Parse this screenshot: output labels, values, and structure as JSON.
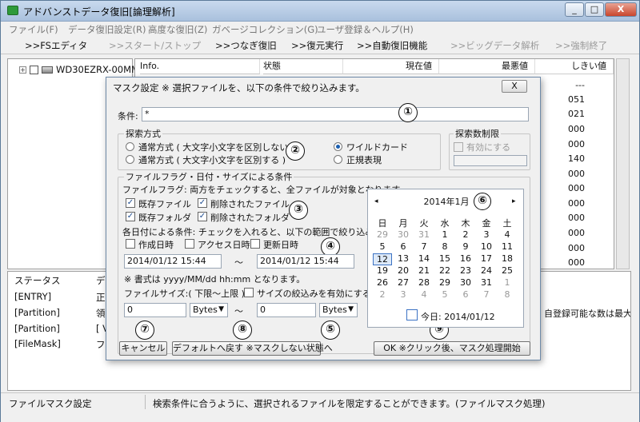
{
  "window": {
    "title": "アドバンストデータ復旧[論理解析]",
    "controls": [
      "_",
      "□",
      "X"
    ]
  },
  "menu": [
    "ファイル(F)",
    "データ復旧設定(R)",
    "高度な復旧(Z)",
    "ガベージコレクション(G)",
    "ユーザ登録＆ヘルプ(H)"
  ],
  "toolbar": [
    {
      "label": ">>FSエディタ",
      "enabled": true
    },
    {
      "label": ">>スタート/ストップ",
      "enabled": false
    },
    {
      "label": ">>つなぎ復旧",
      "enabled": true
    },
    {
      "label": ">>復元実行",
      "enabled": true
    },
    {
      "label": ">>自動復旧機能",
      "enabled": true
    },
    {
      "label": ">>ビッグデータ解析",
      "enabled": false
    },
    {
      "label": ">>強制終了",
      "enabled": false
    }
  ],
  "tree": {
    "expander": "+",
    "label": "WD30EZRX-00MMM"
  },
  "grid": {
    "columns": [
      "Info.",
      "状態",
      "現在値",
      "最悪値",
      "しきい値"
    ],
    "values": [
      "---",
      "051",
      "021",
      "000",
      "000",
      "140",
      "000",
      "000",
      "000",
      "000",
      "000",
      "000",
      "000",
      "000"
    ]
  },
  "log": {
    "columns": [
      "ステータス",
      "デ"
    ],
    "rows": [
      {
        "tag": "[ENTRY]",
        "text": "正"
      },
      {
        "tag": "[Partition]",
        "text": "領"
      },
      {
        "tag": "[Partition]",
        "text": "[ V"
      },
      {
        "tag": "[FileMask]",
        "text": "フ"
      }
    ],
    "tail": "自登録可能な数は最大で"
  },
  "status": {
    "left": "ファイルマスク設定",
    "right": "検索条件に合うように、選択されるファイルを限定することができます。(ファイルマスク処理)"
  },
  "dialog": {
    "title": "マスク設定 ※ 選択ファイルを、以下の条件で絞り込みます。",
    "close": "X",
    "condition_label": "条件:",
    "condition_value": "*",
    "search_group": "探索方式",
    "radio_case_insensitive": "通常方式 ( 大文字小文字を区別しない )",
    "radio_case_sensitive": "通常方式 ( 大文字小文字を区別する )",
    "radio_wildcard": "ワイルドカード",
    "radio_regex": "正規表現",
    "limit_group": "探索数制限",
    "limit_enable": "有効にする",
    "flags_group": "ファイルフラグ・日付・サイズによる条件",
    "flags_note": "ファイルフラグ: 両方をチェックすると、全ファイルが対象となります。",
    "chk_existing_file": "既存ファイル",
    "chk_deleted_file": "削除されたファイル",
    "chk_existing_folder": "既存フォルダ",
    "chk_deleted_folder": "削除されたフォルダ",
    "date_note": "各日付による条件: チェックを入れると、以下の範囲で絞り込みます。",
    "chk_created": "作成日時",
    "chk_accessed": "アクセス日時",
    "chk_updated": "更新日時",
    "date_from": "2014/01/12 15:44",
    "date_to": "2014/01/12 15:44",
    "tilde": "～",
    "format_note": "※ 書式は yyyy/MM/dd hh:mm となります。",
    "size_label": "ファイルサイズ:( 下限～上限 )",
    "size_enable": "サイズの絞込みを有効にする",
    "size_min": "0",
    "size_max": "0",
    "unit_min": "Bytes",
    "unit_max": "Bytes",
    "btn_cancel": "キャンセル",
    "btn_default": "デフォルトへ戻す ※マスクしない状態へ",
    "btn_ok": "OK ※クリック後、マスク処理開始",
    "calendar": {
      "title": "2014年1月",
      "prev": "◂",
      "next": "▸",
      "weekdays": [
        "日",
        "月",
        "火",
        "水",
        "木",
        "金",
        "土"
      ],
      "days": [
        "29",
        "30",
        "31",
        "1",
        "2",
        "3",
        "4",
        "5",
        "6",
        "7",
        "8",
        "9",
        "10",
        "11",
        "12",
        "13",
        "14",
        "15",
        "16",
        "17",
        "18",
        "19",
        "20",
        "21",
        "22",
        "23",
        "24",
        "25",
        "26",
        "27",
        "28",
        "29",
        "30",
        "31",
        "1",
        "2",
        "3",
        "4",
        "5",
        "6",
        "7",
        "8"
      ],
      "today_label": "今日: 2014/01/12"
    },
    "markers": [
      "①",
      "②",
      "③",
      "④",
      "⑤",
      "⑥",
      "⑦",
      "⑧",
      "⑨"
    ]
  }
}
